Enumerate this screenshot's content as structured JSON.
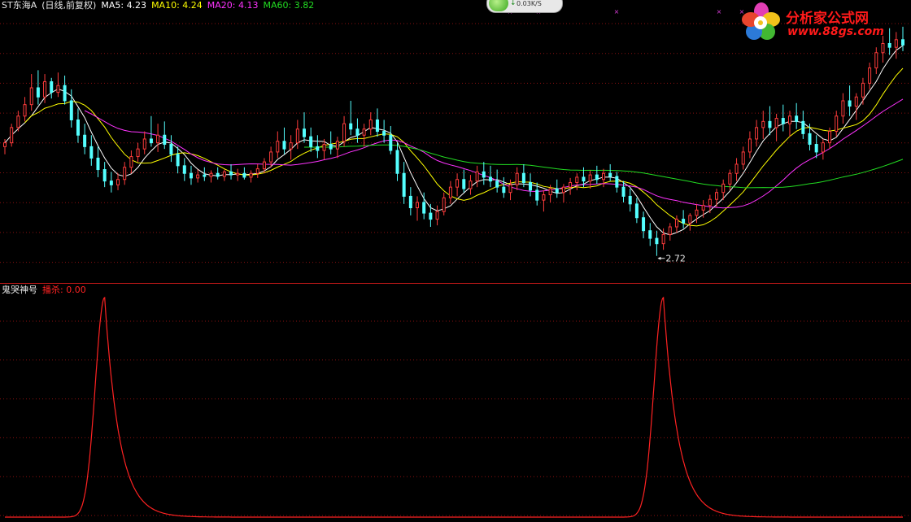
{
  "header": {
    "stock_name": "ST东海A",
    "period": "(日线,前复权)",
    "ma5_label": "MA5:",
    "ma5_value": "4.23",
    "ma10_label": "MA10:",
    "ma10_value": "4.24",
    "ma20_label": "MA20:",
    "ma20_value": "4.13",
    "ma60_label": "MA60:",
    "ma60_value": "3.82",
    "colors": {
      "name": "#e6e6e6",
      "ma5": "#ffffff",
      "ma10": "#ffff00",
      "ma20": "#ff33ff",
      "ma60": "#22dd22"
    }
  },
  "indicator_header": {
    "name": "鬼哭神号",
    "series_label": "播杀:",
    "series_value": "0.00",
    "colors": {
      "name": "#e6e6e6",
      "series": "#ff2222"
    }
  },
  "speed_widget": {
    "text": "0.03K/S",
    "arrow": "↓"
  },
  "logo": {
    "text": "分析家公式网",
    "url": "www.88gs.com"
  },
  "chart_data": [
    {
      "type": "candlestick",
      "min_label": "2.72",
      "candles": [
        [
          4.15,
          4.25,
          4.05,
          4.2
        ],
        [
          4.2,
          4.45,
          4.15,
          4.4
        ],
        [
          4.4,
          4.62,
          4.35,
          4.55
        ],
        [
          4.55,
          4.8,
          4.48,
          4.7
        ],
        [
          4.7,
          5.1,
          4.62,
          4.92
        ],
        [
          4.92,
          5.15,
          4.7,
          4.8
        ],
        [
          4.8,
          5.1,
          4.72,
          5.0
        ],
        [
          5.0,
          5.05,
          4.78,
          4.86
        ],
        [
          4.86,
          5.12,
          4.8,
          4.95
        ],
        [
          4.95,
          5.08,
          4.7,
          4.75
        ],
        [
          4.75,
          4.9,
          4.4,
          4.5
        ],
        [
          4.5,
          4.65,
          4.2,
          4.3
        ],
        [
          4.3,
          4.45,
          4.05,
          4.15
        ],
        [
          4.15,
          4.3,
          3.9,
          4.0
        ],
        [
          4.0,
          4.15,
          3.75,
          3.85
        ],
        [
          3.85,
          3.95,
          3.62,
          3.7
        ],
        [
          3.7,
          3.82,
          3.55,
          3.65
        ],
        [
          3.65,
          3.8,
          3.58,
          3.72
        ],
        [
          3.72,
          3.95,
          3.65,
          3.88
        ],
        [
          3.88,
          4.1,
          3.8,
          4.02
        ],
        [
          4.02,
          4.2,
          3.95,
          4.12
        ],
        [
          4.12,
          4.35,
          4.05,
          4.25
        ],
        [
          4.25,
          4.55,
          4.15,
          4.2
        ],
        [
          4.2,
          4.45,
          4.08,
          4.3
        ],
        [
          4.3,
          4.48,
          4.12,
          4.18
        ],
        [
          4.18,
          4.3,
          3.95,
          4.05
        ],
        [
          4.05,
          4.15,
          3.8,
          3.9
        ],
        [
          3.9,
          4.0,
          3.7,
          3.8
        ],
        [
          3.8,
          3.9,
          3.65,
          3.74
        ],
        [
          3.74,
          3.85,
          3.68,
          3.78
        ],
        [
          3.78,
          3.88,
          3.7,
          3.76
        ],
        [
          3.76,
          3.84,
          3.68,
          3.8
        ],
        [
          3.8,
          3.88,
          3.72,
          3.76
        ],
        [
          3.76,
          3.85,
          3.7,
          3.82
        ],
        [
          3.82,
          3.92,
          3.72,
          3.78
        ],
        [
          3.78,
          3.86,
          3.7,
          3.8
        ],
        [
          3.8,
          3.88,
          3.72,
          3.75
        ],
        [
          3.75,
          3.84,
          3.68,
          3.8
        ],
        [
          3.8,
          3.92,
          3.74,
          3.86
        ],
        [
          3.86,
          4.0,
          3.8,
          3.95
        ],
        [
          3.95,
          4.15,
          3.88,
          4.08
        ],
        [
          4.08,
          4.35,
          4.0,
          4.22
        ],
        [
          4.22,
          4.4,
          4.05,
          4.12
        ],
        [
          4.12,
          4.3,
          3.98,
          4.2
        ],
        [
          4.2,
          4.5,
          4.12,
          4.38
        ],
        [
          4.38,
          4.6,
          4.2,
          4.28
        ],
        [
          4.28,
          4.4,
          4.08,
          4.15
        ],
        [
          4.15,
          4.3,
          4.0,
          4.1
        ],
        [
          4.1,
          4.25,
          3.98,
          4.18
        ],
        [
          4.18,
          4.35,
          4.05,
          4.12
        ],
        [
          4.12,
          4.28,
          4.0,
          4.22
        ],
        [
          4.22,
          4.55,
          4.15,
          4.45
        ],
        [
          4.45,
          4.75,
          4.3,
          4.38
        ],
        [
          4.38,
          4.52,
          4.2,
          4.3
        ],
        [
          4.3,
          4.45,
          4.15,
          4.38
        ],
        [
          4.38,
          4.6,
          4.3,
          4.5
        ],
        [
          4.5,
          4.65,
          4.28,
          4.35
        ],
        [
          4.35,
          4.5,
          4.2,
          4.3
        ],
        [
          4.3,
          4.42,
          4.05,
          4.1
        ],
        [
          4.1,
          4.2,
          3.7,
          3.8
        ],
        [
          3.8,
          3.95,
          3.4,
          3.5
        ],
        [
          3.5,
          3.62,
          3.25,
          3.35
        ],
        [
          3.35,
          3.5,
          3.18,
          3.42
        ],
        [
          3.42,
          3.55,
          3.2,
          3.28
        ],
        [
          3.28,
          3.4,
          3.1,
          3.2
        ],
        [
          3.2,
          3.38,
          3.12,
          3.3
        ],
        [
          3.3,
          3.55,
          3.25,
          3.48
        ],
        [
          3.48,
          3.7,
          3.4,
          3.62
        ],
        [
          3.62,
          3.8,
          3.5,
          3.72
        ],
        [
          3.72,
          3.85,
          3.55,
          3.6
        ],
        [
          3.6,
          3.78,
          3.52,
          3.7
        ],
        [
          3.7,
          3.9,
          3.62,
          3.82
        ],
        [
          3.82,
          3.95,
          3.65,
          3.75
        ],
        [
          3.75,
          3.9,
          3.62,
          3.7
        ],
        [
          3.7,
          3.85,
          3.55,
          3.62
        ],
        [
          3.62,
          3.75,
          3.48,
          3.55
        ],
        [
          3.55,
          3.72,
          3.45,
          3.65
        ],
        [
          3.65,
          3.88,
          3.58,
          3.8
        ],
        [
          3.8,
          3.92,
          3.62,
          3.68
        ],
        [
          3.68,
          3.8,
          3.5,
          3.58
        ],
        [
          3.58,
          3.68,
          3.38,
          3.45
        ],
        [
          3.45,
          3.58,
          3.3,
          3.52
        ],
        [
          3.52,
          3.65,
          3.42,
          3.6
        ],
        [
          3.6,
          3.72,
          3.48,
          3.55
        ],
        [
          3.55,
          3.66,
          3.42,
          3.62
        ],
        [
          3.62,
          3.74,
          3.52,
          3.68
        ],
        [
          3.68,
          3.8,
          3.58,
          3.75
        ],
        [
          3.75,
          3.88,
          3.62,
          3.7
        ],
        [
          3.7,
          3.84,
          3.6,
          3.78
        ],
        [
          3.78,
          3.9,
          3.66,
          3.72
        ],
        [
          3.72,
          3.86,
          3.62,
          3.8
        ],
        [
          3.8,
          3.92,
          3.7,
          3.76
        ],
        [
          3.76,
          3.82,
          3.55,
          3.62
        ],
        [
          3.62,
          3.7,
          3.42,
          3.5
        ],
        [
          3.5,
          3.6,
          3.3,
          3.4
        ],
        [
          3.4,
          3.48,
          3.15,
          3.22
        ],
        [
          3.22,
          3.3,
          2.95,
          3.05
        ],
        [
          3.05,
          3.15,
          2.85,
          2.95
        ],
        [
          2.95,
          3.05,
          2.72,
          2.88
        ],
        [
          2.88,
          3.08,
          2.8,
          3.0
        ],
        [
          3.0,
          3.15,
          2.92,
          3.1
        ],
        [
          3.1,
          3.25,
          3.02,
          3.2
        ],
        [
          3.2,
          3.32,
          3.08,
          3.15
        ],
        [
          3.15,
          3.28,
          3.05,
          3.25
        ],
        [
          3.25,
          3.4,
          3.15,
          3.32
        ],
        [
          3.32,
          3.45,
          3.22,
          3.38
        ],
        [
          3.38,
          3.52,
          3.28,
          3.46
        ],
        [
          3.46,
          3.6,
          3.36,
          3.55
        ],
        [
          3.55,
          3.72,
          3.45,
          3.66
        ],
        [
          3.66,
          3.85,
          3.58,
          3.8
        ],
        [
          3.8,
          4.0,
          3.7,
          3.92
        ],
        [
          3.92,
          4.15,
          3.85,
          4.08
        ],
        [
          4.08,
          4.35,
          4.0,
          4.25
        ],
        [
          4.25,
          4.5,
          4.15,
          4.4
        ],
        [
          4.4,
          4.62,
          4.25,
          4.48
        ],
        [
          4.48,
          4.68,
          4.3,
          4.4
        ],
        [
          4.4,
          4.58,
          4.22,
          4.52
        ],
        [
          4.52,
          4.7,
          4.35,
          4.45
        ],
        [
          4.45,
          4.62,
          4.28,
          4.55
        ],
        [
          4.55,
          4.72,
          4.38,
          4.48
        ],
        [
          4.48,
          4.62,
          4.25,
          4.32
        ],
        [
          4.32,
          4.45,
          4.1,
          4.18
        ],
        [
          4.18,
          4.3,
          4.0,
          4.08
        ],
        [
          4.08,
          4.25,
          3.98,
          4.2
        ],
        [
          4.2,
          4.4,
          4.12,
          4.35
        ],
        [
          4.35,
          4.62,
          4.28,
          4.55
        ],
        [
          4.55,
          4.85,
          4.45,
          4.75
        ],
        [
          4.75,
          4.95,
          4.55,
          4.68
        ],
        [
          4.68,
          4.85,
          4.5,
          4.8
        ],
        [
          4.8,
          5.05,
          4.7,
          4.98
        ],
        [
          4.98,
          5.25,
          4.9,
          5.18
        ],
        [
          5.18,
          5.45,
          5.1,
          5.38
        ],
        [
          5.38,
          5.6,
          5.25,
          5.5
        ],
        [
          5.5,
          5.7,
          5.35,
          5.45
        ],
        [
          5.45,
          5.65,
          5.3,
          5.55
        ],
        [
          5.55,
          5.72,
          5.4,
          5.48
        ]
      ]
    },
    {
      "type": "line",
      "series_name": "播杀",
      "peaks": [
        {
          "index": 15,
          "value": 100
        },
        {
          "index": 99,
          "value": 100
        }
      ],
      "ylim": [
        0,
        100
      ],
      "last_value": 0.0
    }
  ]
}
